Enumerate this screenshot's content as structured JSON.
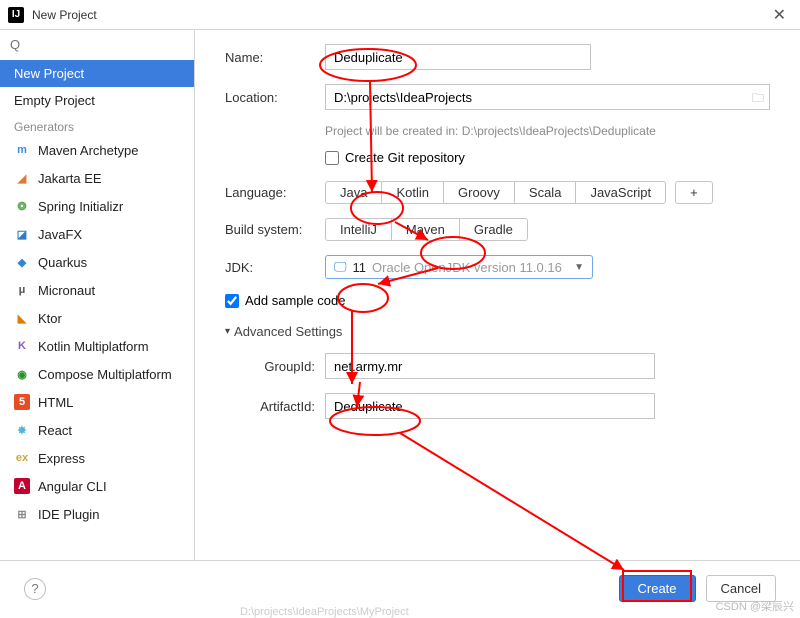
{
  "titlebar": {
    "title": "New Project",
    "logo": "IJ"
  },
  "search": {
    "placeholder": "Q"
  },
  "sidebar": {
    "items": [
      {
        "label": "New Project",
        "selected": true
      },
      {
        "label": "Empty Project"
      }
    ],
    "generators_label": "Generators",
    "generators": [
      {
        "label": "Maven Archetype",
        "glyph": "m",
        "color": "#3a8de0",
        "bg": "transparent"
      },
      {
        "label": "Jakarta EE",
        "glyph": "◢",
        "color": "#e07b2e",
        "bg": "transparent"
      },
      {
        "label": "Spring Initializr",
        "glyph": "❂",
        "color": "#57a84f",
        "bg": "transparent"
      },
      {
        "label": "JavaFX",
        "glyph": "◪",
        "color": "#2e7cc4",
        "bg": "transparent"
      },
      {
        "label": "Quarkus",
        "glyph": "◆",
        "color": "#3286d8",
        "bg": "transparent"
      },
      {
        "label": "Micronaut",
        "glyph": "μ",
        "color": "#555",
        "bg": "transparent"
      },
      {
        "label": "Ktor",
        "glyph": "◣",
        "color": "#e07b00",
        "bg": "transparent"
      },
      {
        "label": "Kotlin Multiplatform",
        "glyph": "K",
        "color": "#8e5acb",
        "bg": "transparent"
      },
      {
        "label": "Compose Multiplatform",
        "glyph": "◉",
        "color": "#2b8f2b",
        "bg": "transparent"
      },
      {
        "label": "HTML",
        "glyph": "5",
        "color": "#fff",
        "bg": "#e44d26"
      },
      {
        "label": "React",
        "glyph": "✸",
        "color": "#4fb6d6",
        "bg": "transparent"
      },
      {
        "label": "Express",
        "glyph": "ex",
        "color": "#c7a542",
        "bg": "transparent"
      },
      {
        "label": "Angular CLI",
        "glyph": "A",
        "color": "#fff",
        "bg": "#c3002f"
      },
      {
        "label": "IDE Plugin",
        "glyph": "⊞",
        "color": "#8a8a8a",
        "bg": "transparent"
      }
    ]
  },
  "form": {
    "name_label": "Name:",
    "name_value": "Deduplicate",
    "location_label": "Location:",
    "location_value": "D:\\projects\\IdeaProjects",
    "location_hint": "Project will be created in: D:\\projects\\IdeaProjects\\Deduplicate",
    "git_label": "Create Git repository",
    "git_checked": false,
    "language_label": "Language:",
    "languages": [
      "Java",
      "Kotlin",
      "Groovy",
      "Scala",
      "JavaScript"
    ],
    "language_selected": "Java",
    "build_label": "Build system:",
    "builds": [
      "IntelliJ",
      "Maven",
      "Gradle"
    ],
    "build_selected": "Maven",
    "jdk_label": "JDK:",
    "jdk_version": "11",
    "jdk_detail": "Oracle OpenJDK version 11.0.16",
    "sample_label": "Add sample code",
    "sample_checked": true,
    "advanced_label": "Advanced Settings",
    "group_label": "GroupId:",
    "group_value": "net.army.mr",
    "artifact_label": "ArtifactId:",
    "artifact_value": "Deduplicate"
  },
  "footer": {
    "create_label": "Create",
    "cancel_label": "Cancel",
    "ghost": "D:\\projects\\IdeaProjects\\MyProject"
  },
  "watermark": "CSDN @梁辰兴"
}
